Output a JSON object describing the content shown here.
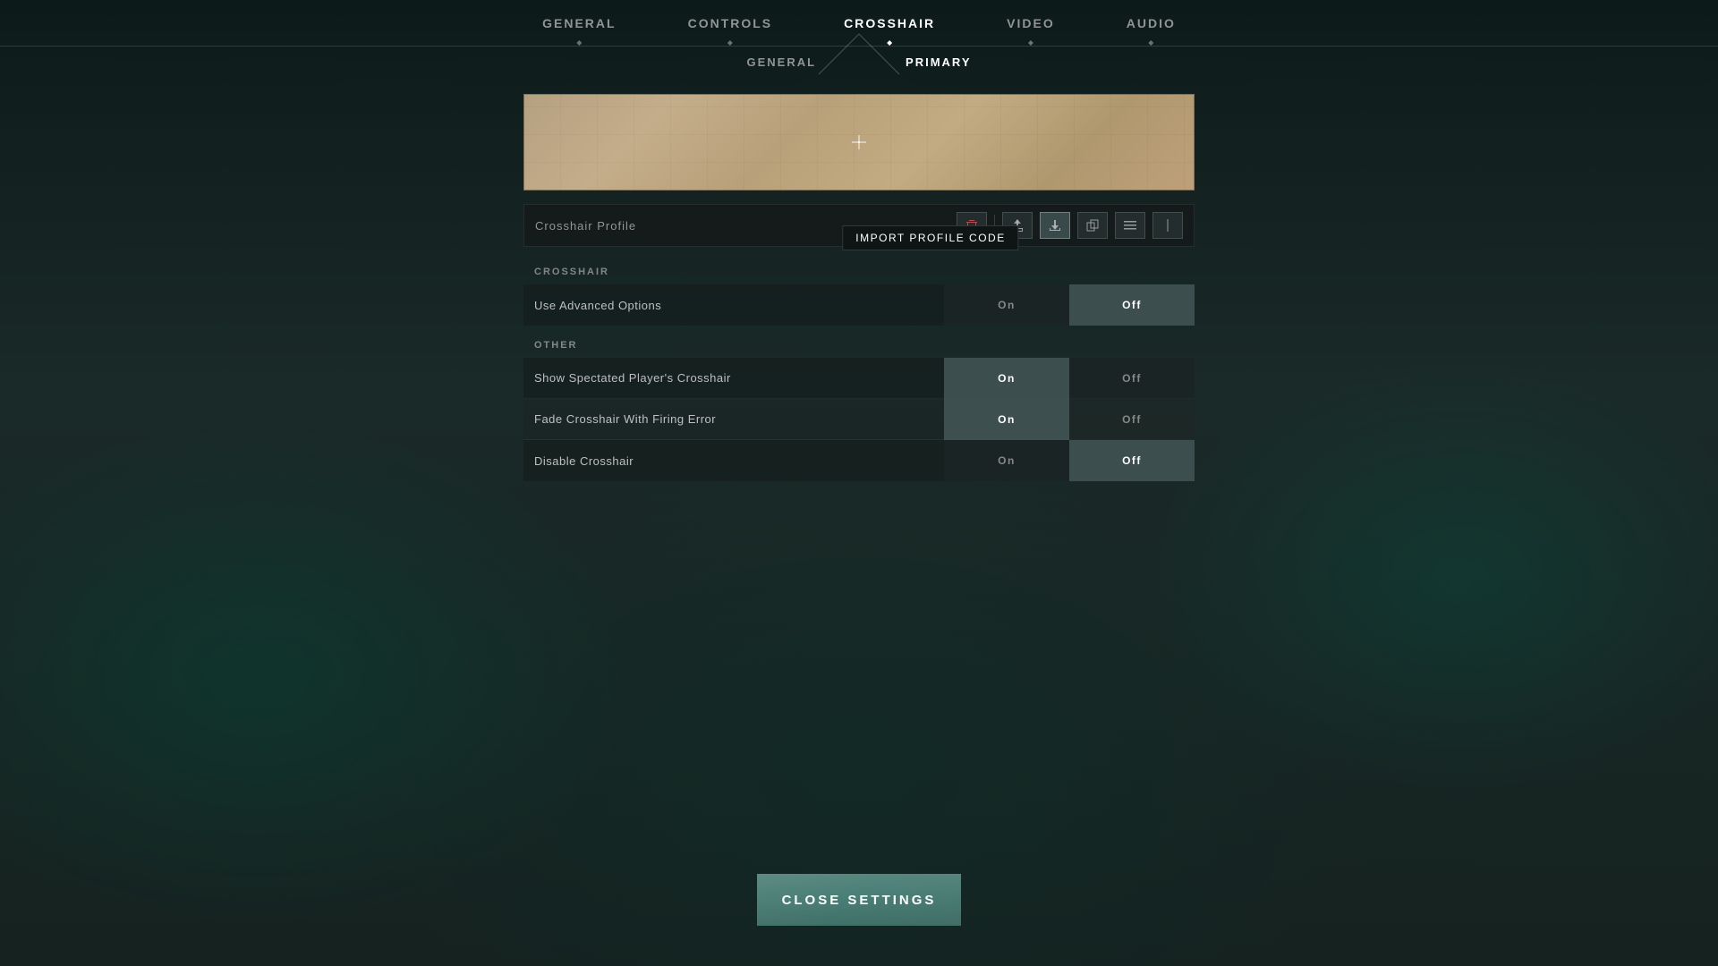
{
  "nav": {
    "items": [
      {
        "id": "general",
        "label": "GENERAL",
        "active": false
      },
      {
        "id": "controls",
        "label": "CONTROLS",
        "active": false
      },
      {
        "id": "crosshair",
        "label": "CROSSHAIR",
        "active": true
      },
      {
        "id": "video",
        "label": "VIDEO",
        "active": false
      },
      {
        "id": "audio",
        "label": "AUDIO",
        "active": false
      }
    ]
  },
  "sub_tabs": {
    "items": [
      {
        "id": "general",
        "label": "GENERAL",
        "active": false
      },
      {
        "id": "primary",
        "label": "PRIMARY",
        "active": true
      }
    ]
  },
  "profile": {
    "label": "Crosshair Profile",
    "buttons": [
      {
        "id": "delete",
        "icon": "🗑",
        "tooltip": null
      },
      {
        "id": "share",
        "icon": "↑",
        "tooltip": null
      },
      {
        "id": "import",
        "icon": "↓",
        "tooltip": null
      },
      {
        "id": "copy",
        "icon": "⧉",
        "tooltip": null
      },
      {
        "id": "menu",
        "icon": "≡",
        "tooltip": null
      },
      {
        "id": "slider",
        "icon": "|",
        "tooltip": null
      }
    ]
  },
  "tooltip": {
    "text": "IMPORT PROFILE CODE"
  },
  "crosshair_section": {
    "title": "CROSSHAIR",
    "rows": [
      {
        "label": "Use Advanced Options",
        "on_selected": false,
        "off_selected": true
      }
    ]
  },
  "other_section": {
    "title": "OTHER",
    "rows": [
      {
        "label": "Show Spectated Player's Crosshair",
        "on_selected": true,
        "off_selected": false
      },
      {
        "label": "Fade Crosshair With Firing Error",
        "on_selected": true,
        "off_selected": false
      },
      {
        "label": "Disable Crosshair",
        "on_selected": false,
        "off_selected": true
      }
    ]
  },
  "buttons": {
    "close_settings": "CLOSE SETTINGS",
    "on_label": "On",
    "off_label": "Off"
  },
  "colors": {
    "selected_bg": "rgba(70,90,90,0.8)",
    "accent": "#5ab8a8",
    "nav_active": "#ffffff"
  }
}
